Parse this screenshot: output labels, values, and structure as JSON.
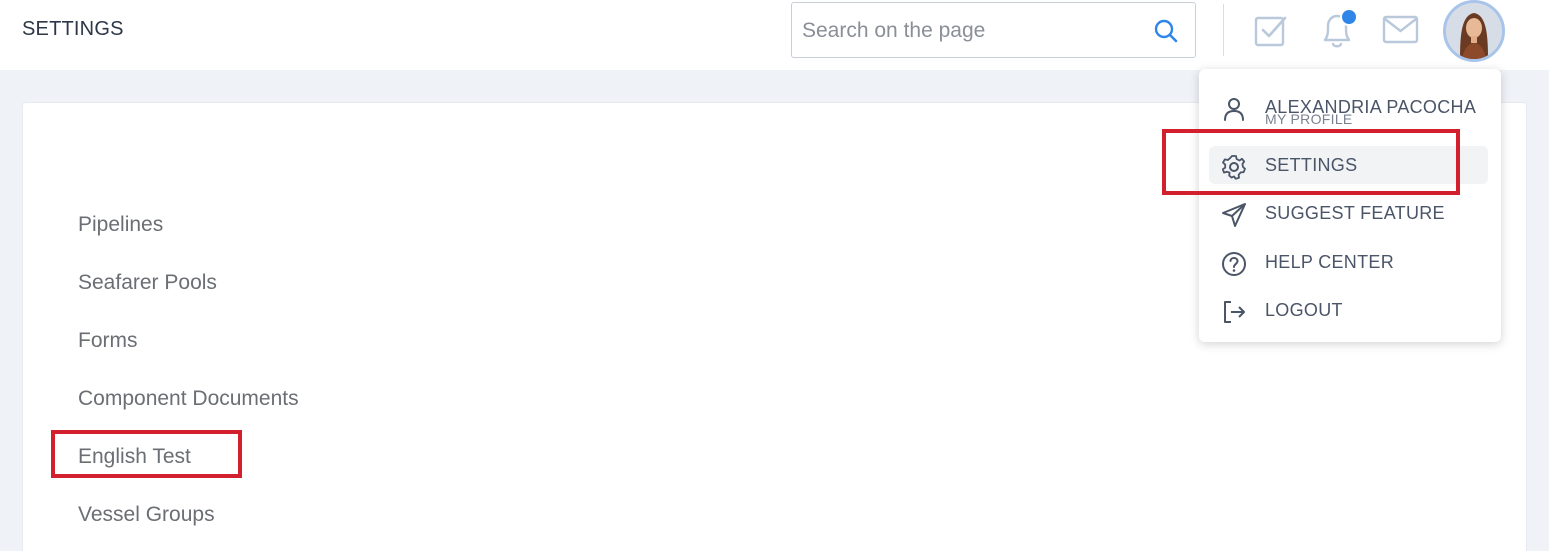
{
  "header": {
    "title": "SETTINGS",
    "search": {
      "placeholder": "Search on the page",
      "value": ""
    },
    "icons": [
      "task-check-icon",
      "bell-icon",
      "mail-icon"
    ],
    "notification_dot_color": "#2f86e8"
  },
  "settings_menu": {
    "items": [
      {
        "label": "Pipelines"
      },
      {
        "label": "Seafarer Pools"
      },
      {
        "label": "Forms"
      },
      {
        "label": "Component Documents"
      },
      {
        "label": "English Test"
      },
      {
        "label": "Vessel Groups"
      }
    ]
  },
  "user_dropdown": {
    "user_name": "ALEXANDRIA PACOCHA",
    "profile_label": "MY PROFILE",
    "items": [
      {
        "label": "SETTINGS",
        "icon": "gear-icon"
      },
      {
        "label": "SUGGEST FEATURE",
        "icon": "paper-plane-icon"
      },
      {
        "label": "HELP CENTER",
        "icon": "question-circle-icon"
      },
      {
        "label": "LOGOUT",
        "icon": "logout-icon"
      }
    ]
  },
  "annotations": {
    "highlight_color": "#d3202f"
  }
}
